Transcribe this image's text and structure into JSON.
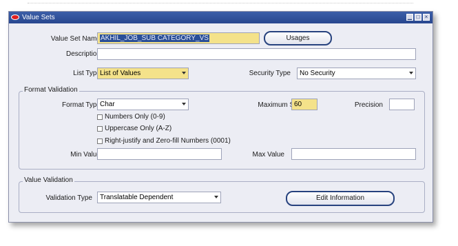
{
  "window": {
    "title": "Value Sets"
  },
  "form": {
    "value_set_name": {
      "label": "Value Set Name",
      "value": "AKHIL_JOB_SUB CATEGORY_VS"
    },
    "usages_button": "Usages",
    "description": {
      "label": "Description",
      "value": ""
    },
    "list_type": {
      "label": "List Type",
      "value": "List of Values"
    },
    "security_type": {
      "label": "Security Type",
      "value": "No Security"
    }
  },
  "format_validation": {
    "title": "Format Validation",
    "format_type": {
      "label": "Format Type",
      "value": "Char"
    },
    "maximum_size": {
      "label": "Maximum Size",
      "value": "60"
    },
    "precision": {
      "label": "Precision",
      "value": ""
    },
    "options": [
      {
        "label": "Numbers Only (0-9)",
        "checked": false
      },
      {
        "label": "Uppercase Only (A-Z)",
        "checked": false
      },
      {
        "label": "Right-justify and Zero-fill Numbers (0001)",
        "checked": false
      }
    ],
    "min_value": {
      "label": "Min Value",
      "value": ""
    },
    "max_value": {
      "label": "Max Value",
      "value": ""
    }
  },
  "value_validation": {
    "title": "Value Validation",
    "validation_type": {
      "label": "Validation Type",
      "value": "Translatable Dependent"
    },
    "edit_information_button": "Edit Information"
  },
  "colors": {
    "titlebar": "#2f4f99",
    "highlight_field": "#f4e28a",
    "button_border": "#27427e"
  }
}
